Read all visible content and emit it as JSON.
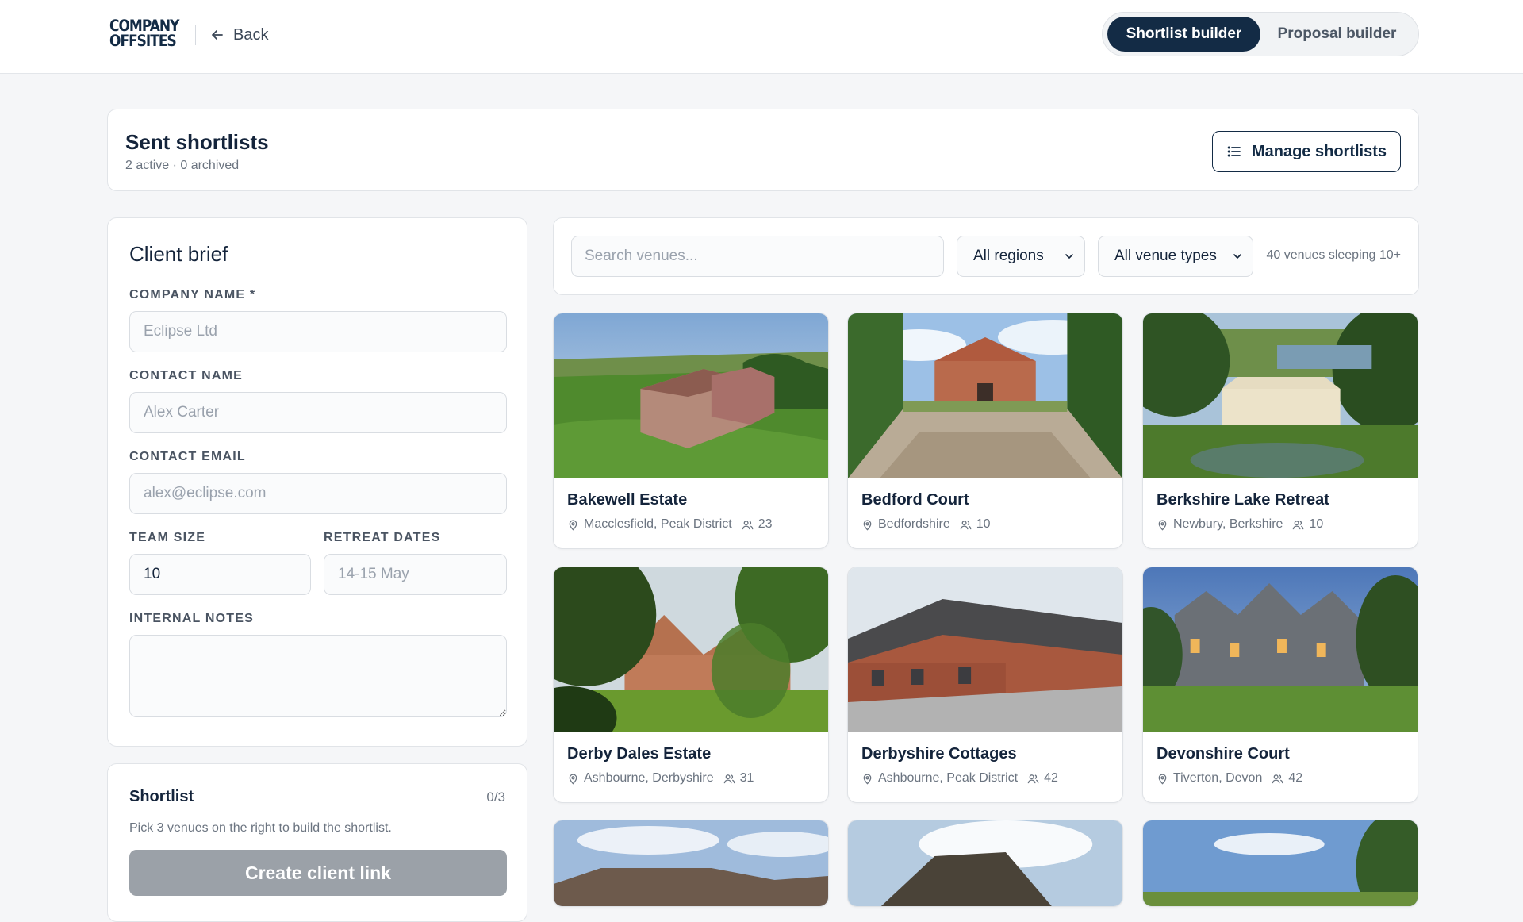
{
  "header": {
    "logo_line1": "COMPANY",
    "logo_line2": "OFFSITES",
    "back_label": "Back",
    "mode_active": "Shortlist builder",
    "mode_inactive": "Proposal builder"
  },
  "sent": {
    "title": "Sent shortlists",
    "subtitle": "2 active · 0 archived",
    "manage_label": "Manage shortlists"
  },
  "brief": {
    "title": "Client brief",
    "company_label": "COMPANY NAME *",
    "company_placeholder": "Eclipse Ltd",
    "contact_label": "CONTACT NAME",
    "contact_placeholder": "Alex Carter",
    "email_label": "CONTACT EMAIL",
    "email_placeholder": "alex@eclipse.com",
    "team_label": "TEAM SIZE",
    "team_value": "10",
    "dates_label": "RETREAT DATES",
    "dates_placeholder": "14-15 May",
    "notes_label": "INTERNAL NOTES"
  },
  "shortlist": {
    "title": "Shortlist",
    "count": "0/3",
    "hint": "Pick 3 venues on the right to build the shortlist.",
    "create_label": "Create client link"
  },
  "filters": {
    "search_placeholder": "Search venues...",
    "region": "All regions",
    "venue_type": "All venue types",
    "result_count": "40 venues sleeping 10+"
  },
  "venues": [
    {
      "name": "Bakewell Estate",
      "location": "Macclesfield, Peak District",
      "capacity": "23"
    },
    {
      "name": "Bedford Court",
      "location": "Bedfordshire",
      "capacity": "10"
    },
    {
      "name": "Berkshire Lake Retreat",
      "location": "Newbury, Berkshire",
      "capacity": "10"
    },
    {
      "name": "Derby Dales Estate",
      "location": "Ashbourne, Derbyshire",
      "capacity": "31"
    },
    {
      "name": "Derbyshire Cottages",
      "location": "Ashbourne, Peak District",
      "capacity": "42"
    },
    {
      "name": "Devonshire Court",
      "location": "Tiverton, Devon",
      "capacity": "42"
    }
  ],
  "colors": {
    "navy": "#132b45",
    "page_bg": "#f5f6f8",
    "muted_button": "#9ba1a8"
  },
  "icons": [
    "arrow-left-icon",
    "list-icon",
    "chevron-down-icon",
    "map-pin-icon",
    "users-icon"
  ]
}
